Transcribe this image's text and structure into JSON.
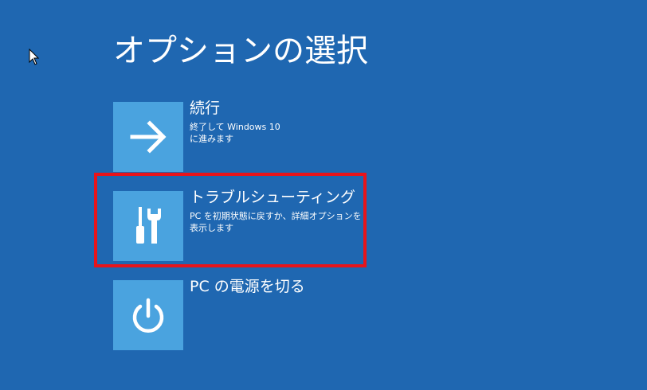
{
  "page_title": "オプションの選択",
  "options": [
    {
      "title": "続行",
      "description": "終了して Windows 10\nに進みます",
      "icon": "arrow-right-icon"
    },
    {
      "title": "トラブルシューティング",
      "description": "PC を初期状態に戻すか、詳細オプションを\n表示します",
      "icon": "tools-icon"
    },
    {
      "title": "PC の電源を切る",
      "description": "",
      "icon": "power-icon"
    }
  ],
  "colors": {
    "background": "#1f67b1",
    "tile": "#4aa3df",
    "highlight": "#e8141b",
    "text": "#ffffff"
  }
}
